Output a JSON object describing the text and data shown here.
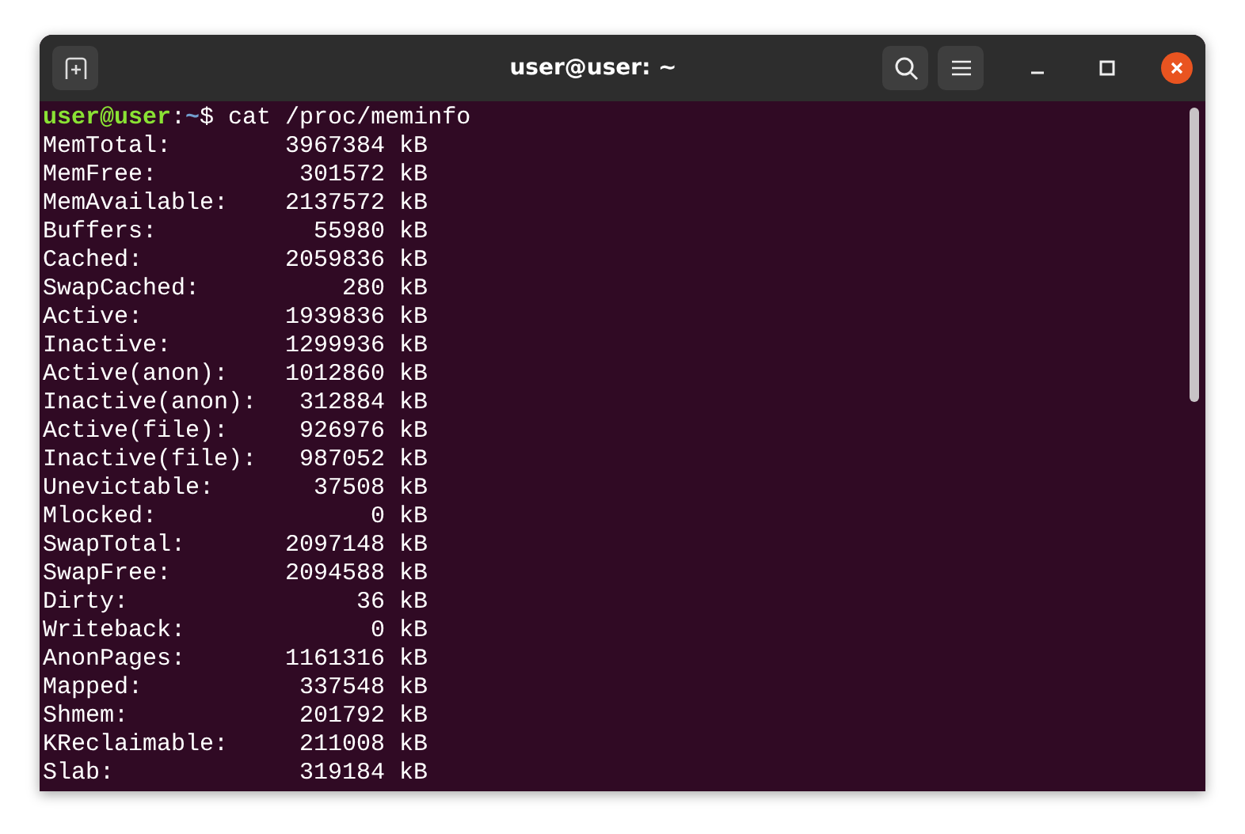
{
  "window": {
    "title": "user@user: ~"
  },
  "prompt": {
    "user": "user@user",
    "separator": ":",
    "path": "~",
    "command": "$ cat /proc/meminfo"
  },
  "rows": [
    {
      "name": "MemTotal:",
      "value": "3967384",
      "unit": "kB"
    },
    {
      "name": "MemFree:",
      "value": "301572",
      "unit": "kB"
    },
    {
      "name": "MemAvailable:",
      "value": "2137572",
      "unit": "kB"
    },
    {
      "name": "Buffers:",
      "value": "55980",
      "unit": "kB"
    },
    {
      "name": "Cached:",
      "value": "2059836",
      "unit": "kB"
    },
    {
      "name": "SwapCached:",
      "value": "280",
      "unit": "kB"
    },
    {
      "name": "Active:",
      "value": "1939836",
      "unit": "kB"
    },
    {
      "name": "Inactive:",
      "value": "1299936",
      "unit": "kB"
    },
    {
      "name": "Active(anon):",
      "value": "1012860",
      "unit": "kB"
    },
    {
      "name": "Inactive(anon):",
      "value": "312884",
      "unit": "kB"
    },
    {
      "name": "Active(file):",
      "value": "926976",
      "unit": "kB"
    },
    {
      "name": "Inactive(file):",
      "value": "987052",
      "unit": "kB"
    },
    {
      "name": "Unevictable:",
      "value": "37508",
      "unit": "kB"
    },
    {
      "name": "Mlocked:",
      "value": "0",
      "unit": "kB"
    },
    {
      "name": "SwapTotal:",
      "value": "2097148",
      "unit": "kB"
    },
    {
      "name": "SwapFree:",
      "value": "2094588",
      "unit": "kB"
    },
    {
      "name": "Dirty:",
      "value": "36",
      "unit": "kB"
    },
    {
      "name": "Writeback:",
      "value": "0",
      "unit": "kB"
    },
    {
      "name": "AnonPages:",
      "value": "1161316",
      "unit": "kB"
    },
    {
      "name": "Mapped:",
      "value": "337548",
      "unit": "kB"
    },
    {
      "name": "Shmem:",
      "value": "201792",
      "unit": "kB"
    },
    {
      "name": "KReclaimable:",
      "value": "211008",
      "unit": "kB"
    },
    {
      "name": "Slab:",
      "value": "319184",
      "unit": "kB"
    }
  ]
}
